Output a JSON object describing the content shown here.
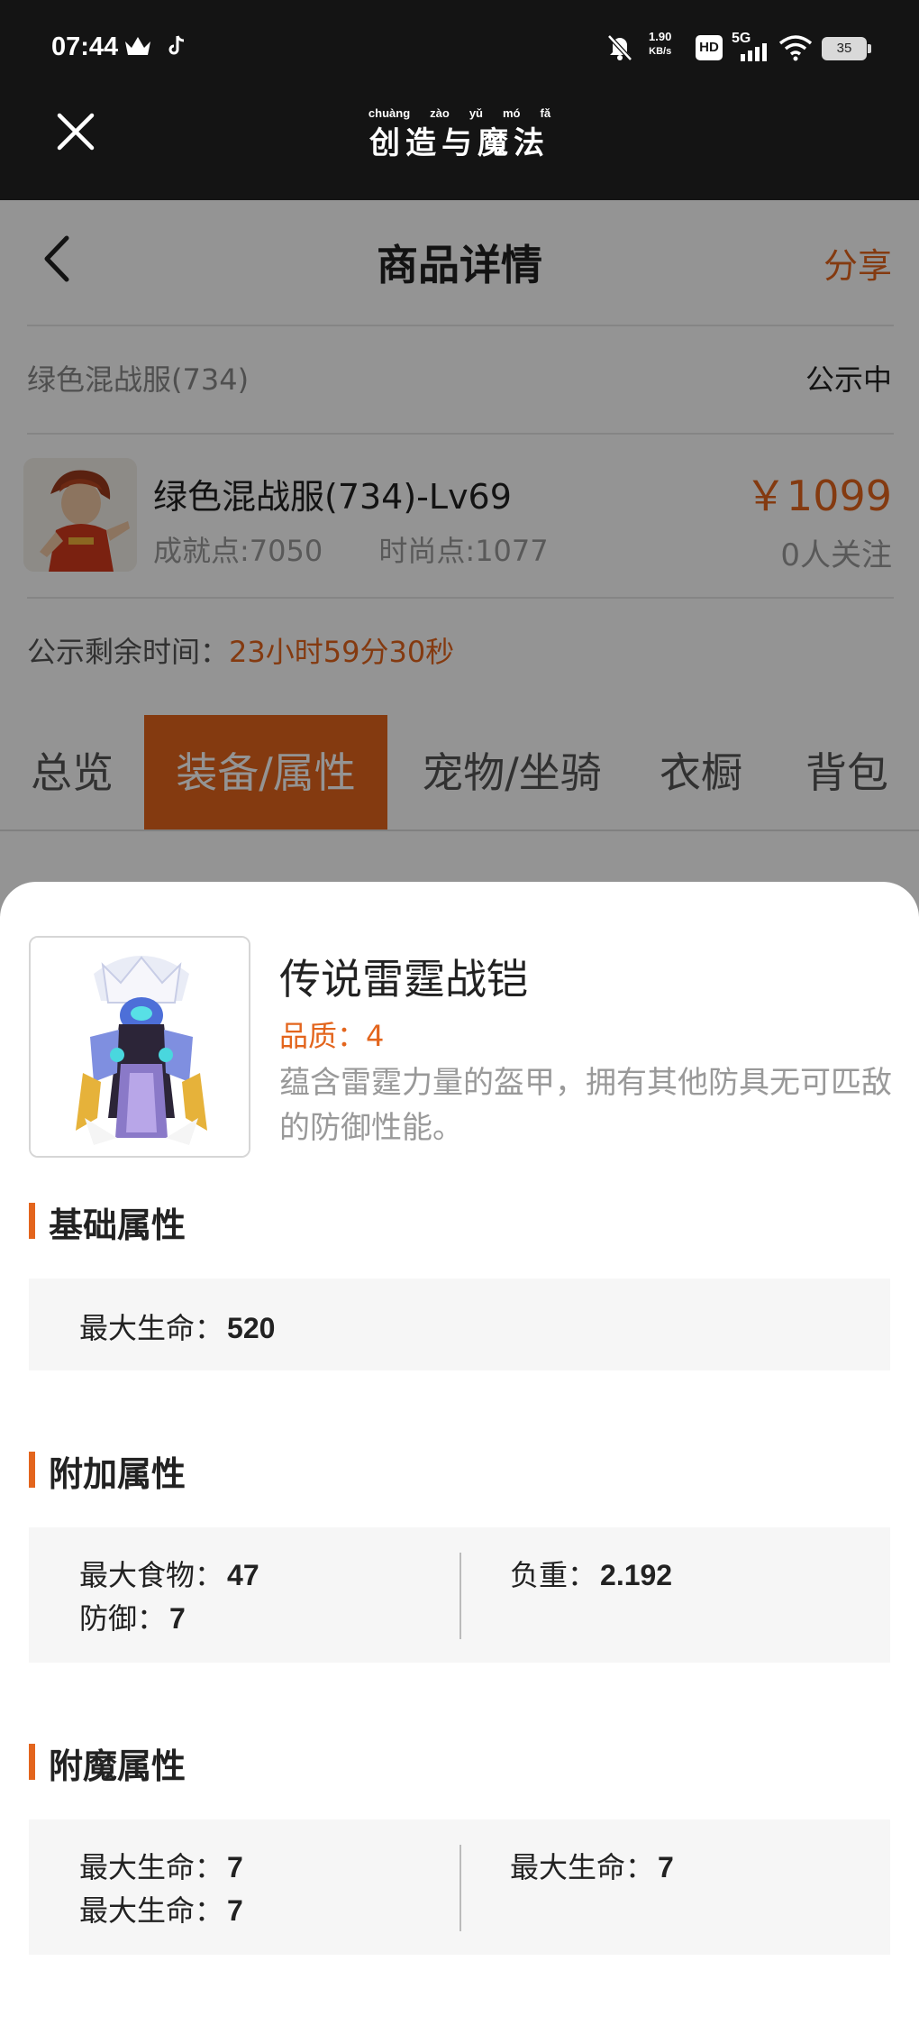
{
  "status_bar": {
    "time": "07:44",
    "net_speed_value": "1.90",
    "net_speed_unit": "KB/s",
    "hd_label": "HD",
    "network_label": "5G",
    "battery": "35",
    "icons": [
      "crown-icon",
      "tiktok-icon",
      "bell-mute-icon",
      "hd-icon",
      "signal-icon",
      "wifi-icon",
      "battery-icon"
    ]
  },
  "app_bar": {
    "close_icon": "close-icon",
    "title_pinyin": [
      "chuàng",
      "zào",
      "yǔ",
      "mó",
      "fǎ"
    ],
    "title": "创造与魔法"
  },
  "page": {
    "title": "商品详情",
    "share_label": "分享",
    "item_name": "绿色混战服(734)",
    "item_status": "公示中",
    "goods_title": "绿色混战服(734)-Lv69",
    "achievement": "成就点:7050",
    "fashion": "时尚点:1077",
    "price": "￥1099",
    "followers": "0人关注",
    "countdown_label": "公示剩余时间：",
    "countdown_value": "23小时59分30秒",
    "tabs": [
      {
        "label": "总览",
        "active": false
      },
      {
        "label": "装备/属性",
        "active": true
      },
      {
        "label": "宠物/坐骑",
        "active": false
      },
      {
        "label": "衣橱",
        "active": false
      },
      {
        "label": "背包",
        "active": false
      }
    ]
  },
  "sheet": {
    "equip_name": "传说雷霆战铠",
    "quality": "品质：4",
    "description": "蕴含雷霆力量的盔甲，拥有其他防具无可匹敌的防御性能。",
    "sections": {
      "basic": {
        "title": "基础属性",
        "attrs": [
          {
            "label": "最大生命：",
            "value": "520"
          }
        ]
      },
      "extra": {
        "title": "附加属性",
        "left": [
          {
            "label": "最大食物：",
            "value": "47"
          },
          {
            "label": "防御：",
            "value": "7"
          }
        ],
        "right": [
          {
            "label": "负重：",
            "value": "2.192"
          }
        ]
      },
      "enchant": {
        "title": "附魔属性",
        "left": [
          {
            "label": "最大生命：",
            "value": "7"
          },
          {
            "label": "最大生命：",
            "value": "7"
          }
        ],
        "right": [
          {
            "label": "最大生命：",
            "value": "7"
          }
        ]
      }
    }
  },
  "colors": {
    "accent": "#e3651d",
    "dark_bar": "#141414",
    "attr_bg": "#f6f6f6"
  }
}
